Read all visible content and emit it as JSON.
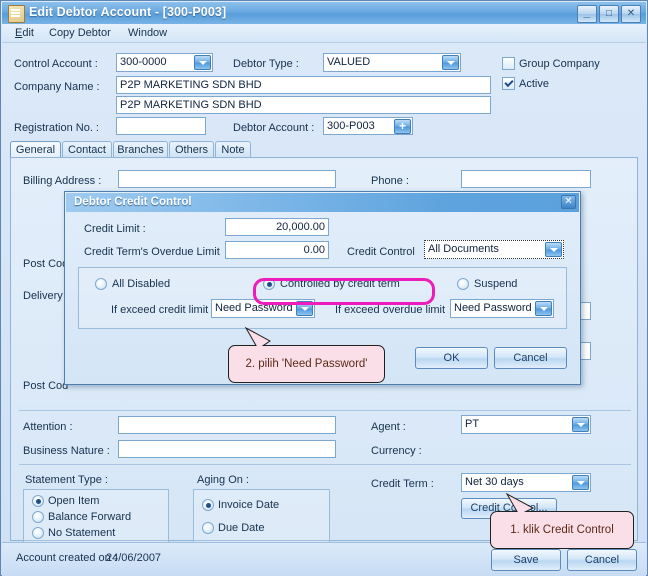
{
  "window": {
    "title": "Edit Debtor Account - [300-P003]",
    "icon": "notepad-icon",
    "minimize": "_",
    "maximize": "□",
    "close": "✕"
  },
  "menu": [
    {
      "label": "Edit",
      "mnemonic": "E"
    },
    {
      "label": "Copy Debtor"
    },
    {
      "label": "Window"
    }
  ],
  "header": {
    "control_account_label": "Control Account :",
    "control_account_value": "300-0000",
    "debtor_type_label": "Debtor Type :",
    "debtor_type_value": "VALUED",
    "company_name_label": "Company Name :",
    "company_name_value": "P2P MARKETING SDN BHD",
    "company_name_value2": "P2P MARKETING SDN BHD",
    "registration_label": "Registration No. :",
    "registration_value": "",
    "debtor_account_label": "Debtor Account :",
    "debtor_account_value": "300-P003",
    "group_company_label": "Group Company",
    "group_company_checked": false,
    "active_label": "Active",
    "active_checked": true
  },
  "tabs": [
    {
      "label": "General",
      "active": true
    },
    {
      "label": "Contact",
      "active": false
    },
    {
      "label": "Branches",
      "active": false
    },
    {
      "label": "Others",
      "active": false
    },
    {
      "label": "Note",
      "active": false
    }
  ],
  "general": {
    "billing_address_label": "Billing Address :",
    "billing_address_value": "",
    "phone_label": "Phone :",
    "phone_value": "",
    "post_code_label_1": "Post Cod",
    "delivery_label": "Delivery",
    "post_code_label_2": "Post Cod",
    "attention_label": "Attention :",
    "attention_value": "",
    "business_nature_label": "Business Nature :",
    "business_nature_value": "",
    "agent_label": "Agent :",
    "agent_value": "PT",
    "currency_label": "Currency :",
    "credit_term_label": "Credit Term :",
    "credit_term_value": "Net 30 days",
    "credit_control_button": "Credit Control...",
    "statement_type_label": "Statement Type :",
    "statement_options": [
      {
        "label": "Open Item",
        "selected": true
      },
      {
        "label": "Balance Forward",
        "selected": false
      },
      {
        "label": "No Statement",
        "selected": false
      }
    ],
    "aging_on_label": "Aging On :",
    "aging_options": [
      {
        "label": "Invoice Date",
        "selected": true
      },
      {
        "label": "Due Date",
        "selected": false
      }
    ]
  },
  "status": {
    "created_label": "Account created on :",
    "created_value": "24/06/2007",
    "save_label": "Save",
    "cancel_label": "Cancel"
  },
  "dialog": {
    "title": "Debtor Credit Control",
    "close": "✕",
    "credit_limit_label": "Credit Limit :",
    "credit_limit_value": "20,000.00",
    "overdue_limit_label": "Credit Term's Overdue Limit",
    "overdue_limit_value": "0.00",
    "credit_control_label": "Credit Control",
    "credit_control_value": "All Documents",
    "modes": [
      {
        "label": "All Disabled",
        "selected": false
      },
      {
        "label": "Controlled by credit term",
        "selected": true
      },
      {
        "label": "Suspend",
        "selected": false
      }
    ],
    "exceed_credit_label": "If exceed credit limit",
    "exceed_credit_value": "Need Password",
    "exceed_overdue_label": "If exceed overdue limit",
    "exceed_overdue_value": "Need Password",
    "ok_label": "OK",
    "cancel_label": "Cancel"
  },
  "annotations": {
    "step1": "1. klik Credit Control",
    "step2": "2. pilih 'Need Password'",
    "highlight_color": "#ee1bbe",
    "callout_fill": "#fbdfe8"
  }
}
